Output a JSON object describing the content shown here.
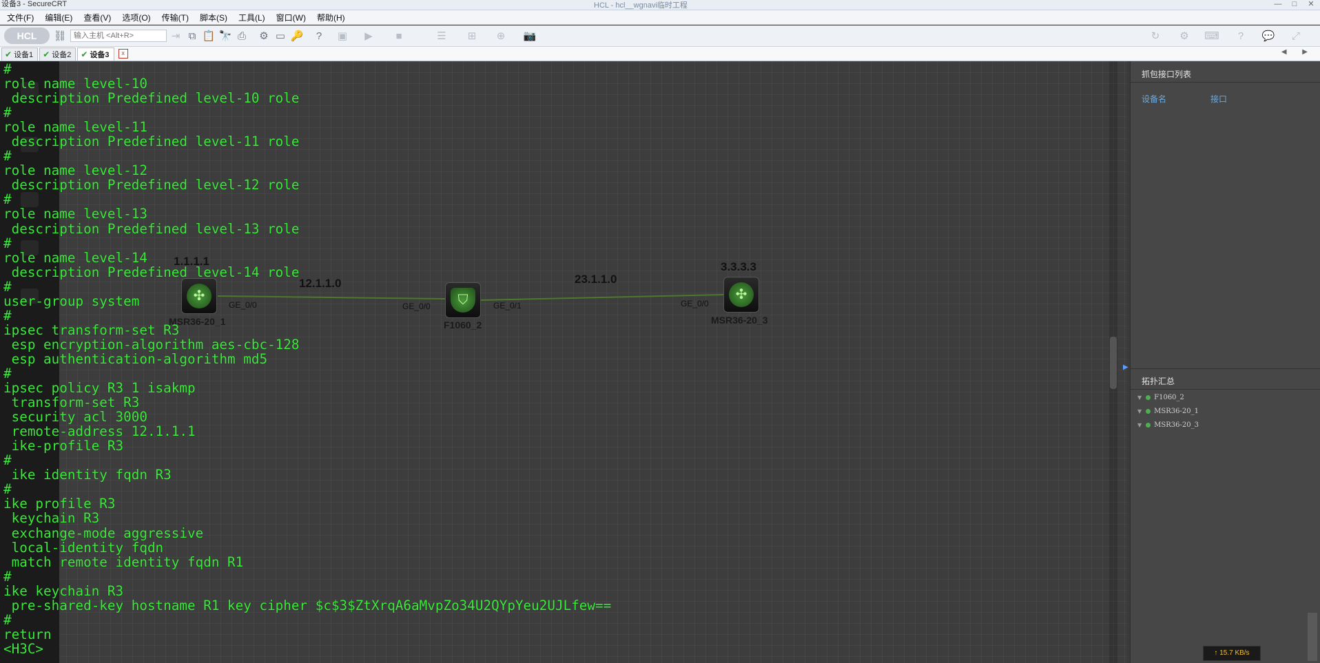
{
  "window": {
    "title": "设备3 - SecureCRT",
    "overlay_title": "HCL - hcl__wgnavi临时工程",
    "minimize": "—",
    "maximize": "□",
    "close": "✕"
  },
  "menu": [
    "文件(F)",
    "编辑(E)",
    "查看(V)",
    "选项(O)",
    "传输(T)",
    "脚本(S)",
    "工具(L)",
    "窗口(W)",
    "帮助(H)"
  ],
  "toolbar": {
    "badge": "HCL",
    "host_placeholder": "输入主机 <Alt+R>"
  },
  "tabs": [
    {
      "label": "设备1",
      "active": false
    },
    {
      "label": "设备2",
      "active": false
    },
    {
      "label": "设备3",
      "active": true
    }
  ],
  "tab_close": "x",
  "tab_scroll": "◀ ▶",
  "terminal": {
    "lines": [
      "#",
      "role name level-10",
      " description Predefined level-10 role",
      "#",
      "role name level-11",
      " description Predefined level-11 role",
      "#",
      "role name level-12",
      " description Predefined level-12 role",
      "#",
      "role name level-13",
      " description Predefined level-13 role",
      "#",
      "role name level-14",
      " description Predefined level-14 role",
      "#",
      "user-group system",
      "#",
      "ipsec transform-set R3",
      " esp encryption-algorithm aes-cbc-128",
      " esp authentication-algorithm md5",
      "#",
      "ipsec policy R3 1 isakmp",
      " transform-set R3",
      " security acl 3000",
      " remote-address 12.1.1.1",
      " ike-profile R3",
      "#",
      " ike identity fqdn R3",
      "#",
      "ike profile R3",
      " keychain R3",
      " exchange-mode aggressive",
      " local-identity fqdn",
      " match remote identity fqdn R1",
      "#",
      "ike keychain R3",
      " pre-shared-key hostname R1 key cipher $c$3$ZtXrqA6aMvpZo34U2QYpYeu2UJLfew==",
      "#",
      "return",
      "<H3C>"
    ]
  },
  "topology": {
    "nodes": [
      {
        "name": "MSR36-20_1",
        "ip": "1.1.1.1",
        "icon": "router-icon"
      },
      {
        "name": "F1060_2",
        "ip": "",
        "icon": "firewall-icon"
      },
      {
        "name": "MSR36-20_3",
        "ip": "3.3.3.3",
        "icon": "router-icon"
      }
    ],
    "links": [
      {
        "network": "12.1.1.0",
        "a_port": "GE_0/0",
        "b_port": "GE_0/0"
      },
      {
        "network": "23.1.1.0",
        "a_port": "GE_0/1",
        "b_port": "GE_0/0"
      }
    ]
  },
  "right_panel": {
    "capture_title": "抓包接口列表",
    "col_device": "设备名",
    "col_interface": "接口",
    "summary_title": "拓扑汇总",
    "summary_items": [
      "F1060_2",
      "MSR36-20_1",
      "MSR36-20_3"
    ]
  },
  "status": {
    "net_speed": "↑ 15.7 KB/s"
  },
  "colors": {
    "terminal_text": "#3bea3b",
    "canvas_bg": "#3d3d3d",
    "link_line": "#4c7a2a",
    "panel_header_text": "#6fa8dc",
    "status_dot": "#4caf50"
  }
}
